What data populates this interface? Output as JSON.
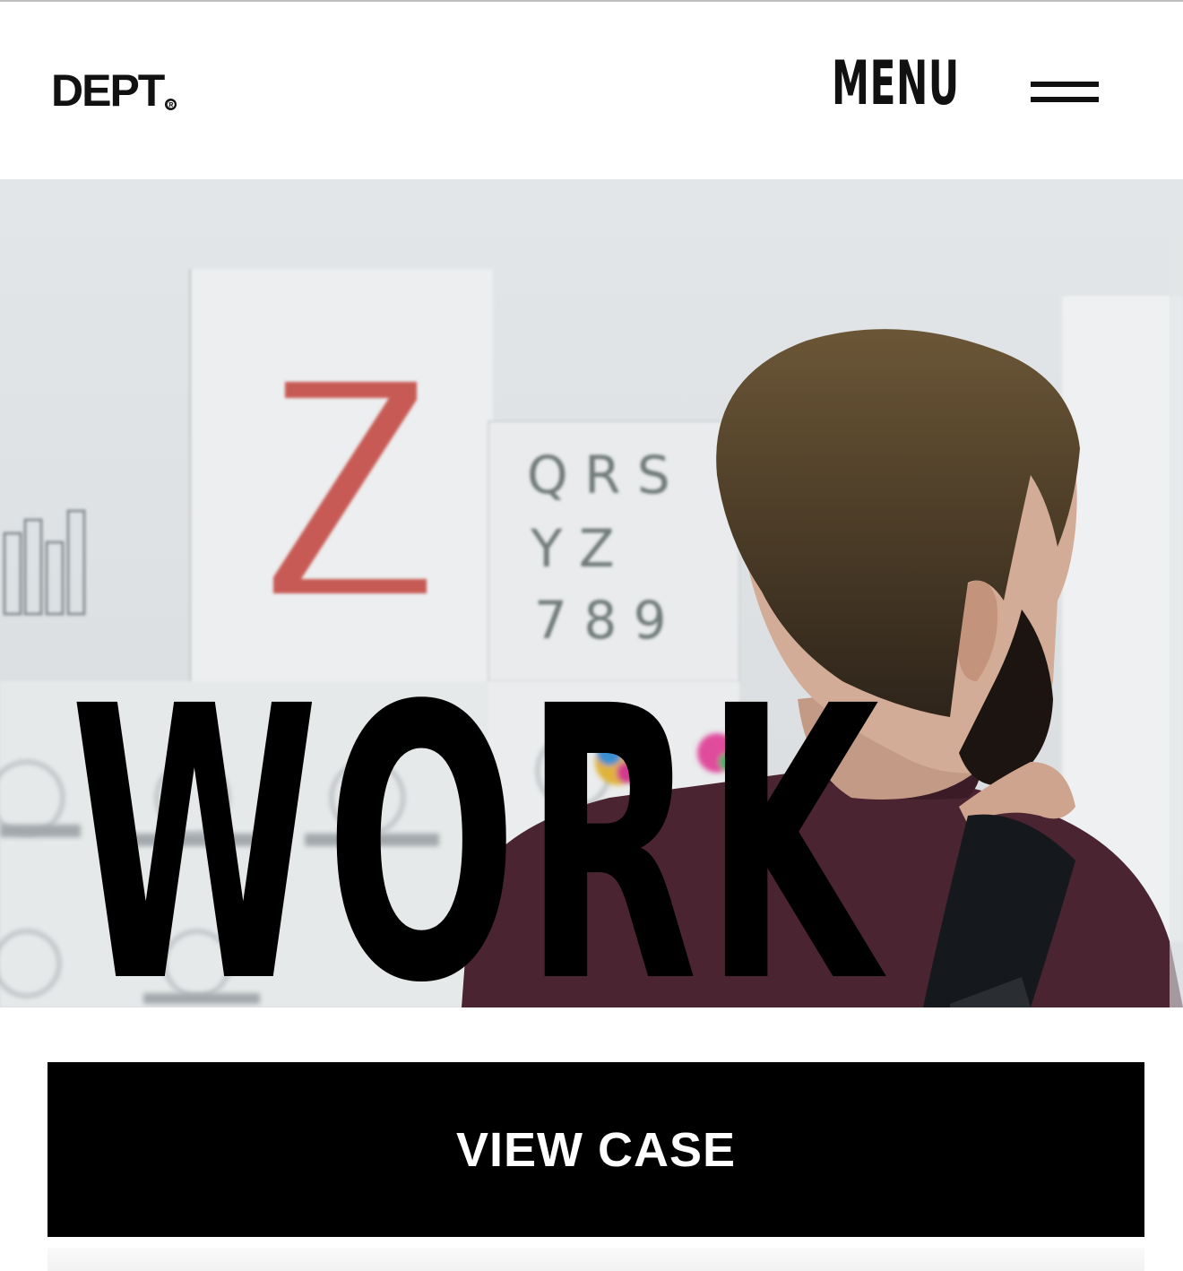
{
  "header": {
    "logo_text": "DEPT",
    "logo_mark": "®",
    "menu_label": "MENU",
    "menu_icon": "hamburger-icon"
  },
  "hero": {
    "title": "WORK",
    "image_subject": "man-looking-at-wall-posters",
    "poster_letters": [
      "Z",
      "Q R S",
      "Y Z",
      "7 8 9"
    ]
  },
  "cta": {
    "label": "VIEW CASE"
  },
  "colors": {
    "background": "#ffffff",
    "text": "#000000",
    "button_bg": "#000000",
    "button_text": "#ffffff",
    "poster_accent": "#c85a55",
    "shirt": "#4a2430"
  }
}
